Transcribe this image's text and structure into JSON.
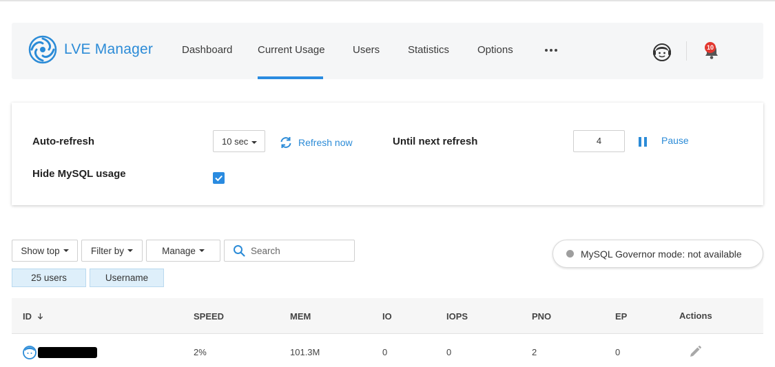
{
  "app": {
    "title": "LVE Manager"
  },
  "nav": {
    "items": [
      {
        "label": "Dashboard"
      },
      {
        "label": "Current Usage"
      },
      {
        "label": "Users"
      },
      {
        "label": "Statistics"
      },
      {
        "label": "Options"
      }
    ],
    "active": "Current Usage",
    "more_icon": "ellipsis-icon"
  },
  "header": {
    "support_icon": "support-agent-icon",
    "notifications_icon": "bell-icon",
    "notification_count": "10"
  },
  "settings": {
    "auto_refresh_label": "Auto-refresh",
    "interval_value": "10 sec",
    "refresh_now_label": "Refresh now",
    "until_next_refresh_label": "Until next refresh",
    "countdown_value": "4",
    "pause_label": "Pause",
    "hide_mysql_label": "Hide MySQL usage",
    "hide_mysql_checked": true
  },
  "toolbar": {
    "show_top_label": "Show top",
    "filter_by_label": "Filter by",
    "manage_label": "Manage",
    "search_placeholder": "Search",
    "tag_users": "25 users",
    "tag_sort": "Username",
    "governor_status": "MySQL Governor mode: not available"
  },
  "table": {
    "columns": [
      "ID",
      "SPEED",
      "MEM",
      "IO",
      "IOPS",
      "PNO",
      "EP",
      "Actions"
    ],
    "sort_column": "ID",
    "rows": [
      {
        "speed": "2%",
        "mem": "101.3M",
        "io": "0",
        "iops": "0",
        "pno": "2",
        "ep": "0"
      }
    ]
  },
  "colors": {
    "accent": "#2a8be0",
    "header_bg": "#f5f6f7",
    "badge": "#e2372f",
    "tag_bg": "#deeffa",
    "governor_dot": "#9e9e9e"
  }
}
